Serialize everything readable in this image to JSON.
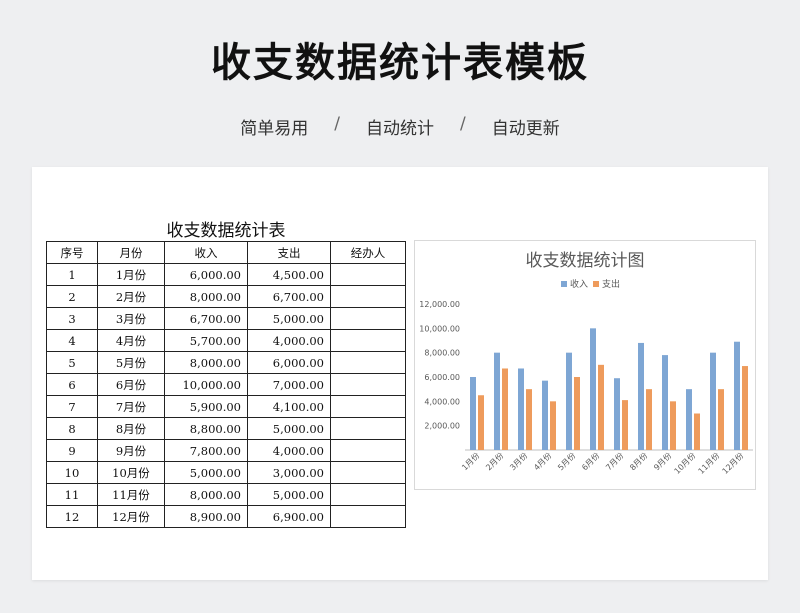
{
  "page": {
    "title": "收支数据统计表模板",
    "subtitle": [
      "简单易用",
      "自动统计",
      "自动更新"
    ],
    "separator": "/"
  },
  "table": {
    "title": "收支数据统计表",
    "headers": [
      "序号",
      "月份",
      "收入",
      "支出",
      "经办人"
    ],
    "rows": [
      [
        "1",
        "1月份",
        "6,000.00",
        "4,500.00",
        ""
      ],
      [
        "2",
        "2月份",
        "8,000.00",
        "6,700.00",
        ""
      ],
      [
        "3",
        "3月份",
        "6,700.00",
        "5,000.00",
        ""
      ],
      [
        "4",
        "4月份",
        "5,700.00",
        "4,000.00",
        ""
      ],
      [
        "5",
        "5月份",
        "8,000.00",
        "6,000.00",
        ""
      ],
      [
        "6",
        "6月份",
        "10,000.00",
        "7,000.00",
        ""
      ],
      [
        "7",
        "7月份",
        "5,900.00",
        "4,100.00",
        ""
      ],
      [
        "8",
        "8月份",
        "8,800.00",
        "5,000.00",
        ""
      ],
      [
        "9",
        "9月份",
        "7,800.00",
        "4,000.00",
        ""
      ],
      [
        "10",
        "10月份",
        "5,000.00",
        "3,000.00",
        ""
      ],
      [
        "11",
        "11月份",
        "8,000.00",
        "5,000.00",
        ""
      ],
      [
        "12",
        "12月份",
        "8,900.00",
        "6,900.00",
        ""
      ]
    ]
  },
  "chart_data": {
    "type": "bar",
    "title": "收支数据统计图",
    "categories": [
      "1月份",
      "2月份",
      "3月份",
      "4月份",
      "5月份",
      "6月份",
      "7月份",
      "8月份",
      "9月份",
      "10月份",
      "11月份",
      "12月份"
    ],
    "series": [
      {
        "name": "收入",
        "color": "#7ea6d4",
        "values": [
          6000,
          8000,
          6700,
          5700,
          8000,
          10000,
          5900,
          8800,
          7800,
          5000,
          8000,
          8900
        ]
      },
      {
        "name": "支出",
        "color": "#ee9b5c",
        "values": [
          4500,
          6700,
          5000,
          4000,
          6000,
          7000,
          4100,
          5000,
          4000,
          3000,
          5000,
          6900
        ]
      }
    ],
    "yticks": [
      "2,000.00",
      "4,000.00",
      "6,000.00",
      "8,000.00",
      "10,000.00",
      "12,000.00"
    ],
    "ylim": [
      0,
      12000
    ],
    "legend_position": "top",
    "grid": false
  }
}
